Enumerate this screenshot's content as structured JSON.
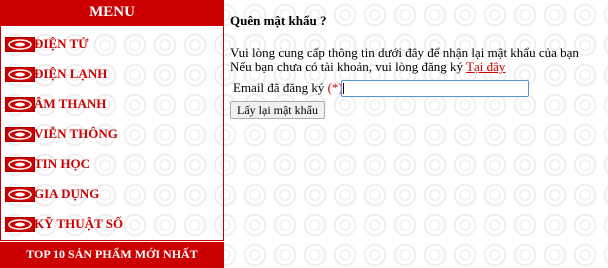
{
  "sidebar": {
    "menu_title": "MENU",
    "items": [
      {
        "label": "ĐIỆN TỬ",
        "icon": "brand-logo-icon"
      },
      {
        "label": "ĐIỆN LẠNH",
        "icon": "brand-logo-icon"
      },
      {
        "label": "ÂM THANH",
        "icon": "brand-logo-icon"
      },
      {
        "label": "VIỄN THÔNG",
        "icon": "brand-logo-icon"
      },
      {
        "label": "TIN HỌC",
        "icon": "brand-logo-icon"
      },
      {
        "label": "GIA DỤNG",
        "icon": "brand-logo-icon"
      },
      {
        "label": "KỸ THUẬT SỐ",
        "icon": "brand-logo-icon"
      }
    ],
    "top10_title": "TOP 10 SẢN PHẨM MỚI NHẤT"
  },
  "main": {
    "title": "Quên mật khẩu ?",
    "desc_line1": "Vui lòng cung cấp thông tin dưới đây để nhận lại mật khẩu của bạn",
    "desc_line2": "Nếu bạn chưa có tài khoản, vui lòng đăng ký",
    "register_link": "Tại đây",
    "email_label": "Email đã đăng ký",
    "required_mark": "(*)",
    "email_value": "",
    "submit_label": "Lấy lại mật khẩu"
  },
  "colors": {
    "brand_red": "#cc0000",
    "input_border": "#5b8fd6"
  }
}
